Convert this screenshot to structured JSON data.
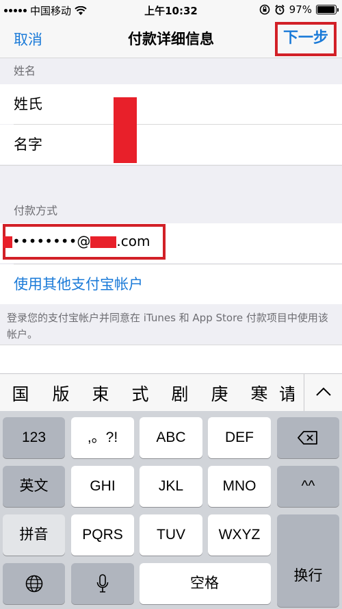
{
  "status_bar": {
    "carrier": "中国移动",
    "time": "上午10:32",
    "battery": "97%",
    "battery_level": 0.97,
    "icons": [
      "signal-icon",
      "wifi-icon",
      "rotation-lock-icon",
      "alarm-icon",
      "battery-icon"
    ]
  },
  "nav": {
    "cancel": "取消",
    "title": "付款详细信息",
    "next": "下一步"
  },
  "name_section": {
    "header": "姓名",
    "last_name": "姓氏",
    "first_name": "名字"
  },
  "payment_section": {
    "header": "付款方式",
    "account_masked": "••••••••@",
    "account_suffix": ".com",
    "use_other": "使用其他支付宝帐户",
    "note": "登录您的支付宝帐户并同意在 iTunes 和 App Store 付款项目中使用该帐户。"
  },
  "candidates": [
    "国",
    "版",
    "束",
    "式",
    "剧",
    "庚",
    "寒",
    "请"
  ],
  "keyboard": {
    "row1": [
      "123",
      ",。?!",
      "ABC",
      "DEF"
    ],
    "row2": [
      "英文",
      "GHI",
      "JKL",
      "MNO",
      "^^"
    ],
    "row3": [
      "拼音",
      "PQRS",
      "TUV",
      "WXYZ"
    ],
    "enter": "换行",
    "space": "空格"
  },
  "colors": {
    "accent": "#1a7ad8",
    "highlight_border": "#d22027",
    "redaction": "#e8202a"
  }
}
